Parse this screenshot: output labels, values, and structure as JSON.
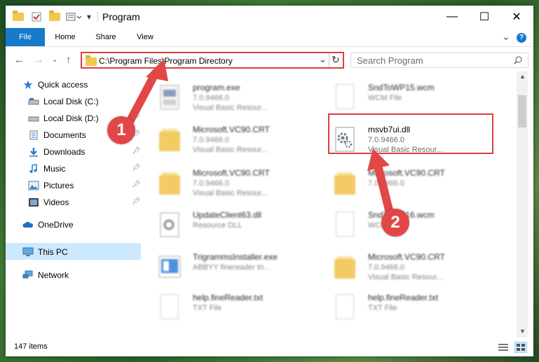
{
  "window": {
    "title": "Program",
    "minimize_glyph": "—",
    "maximize_glyph": "☐",
    "close_glyph": "✕"
  },
  "ribbon": {
    "tabs": [
      "File",
      "Home",
      "Share",
      "View"
    ],
    "expand_glyph": "⌄",
    "help_glyph": "?"
  },
  "address": {
    "path": "C:\\Program Files\\Program Directory",
    "dropdown_glyph": "⌄",
    "refresh_glyph": "↻"
  },
  "search": {
    "placeholder": "Search Program",
    "icon": "search-icon"
  },
  "sidebar": {
    "items": [
      {
        "label": "Quick access",
        "icon": "star-icon"
      },
      {
        "label": "Local Disk (C:)",
        "icon": "drive-icon"
      },
      {
        "label": "Local Disk (D:)",
        "icon": "drive-icon"
      },
      {
        "label": "Documents",
        "icon": "documents-icon"
      },
      {
        "label": "Downloads",
        "icon": "download-icon"
      },
      {
        "label": "Music",
        "icon": "music-icon"
      },
      {
        "label": "Pictures",
        "icon": "pictures-icon"
      },
      {
        "label": "Videos",
        "icon": "videos-icon"
      },
      {
        "label": "OneDrive",
        "icon": "cloud-icon"
      },
      {
        "label": "This PC",
        "icon": "computer-icon"
      },
      {
        "label": "Network",
        "icon": "network-icon"
      }
    ]
  },
  "files": [
    {
      "name": "program.exe",
      "line2": "7.0.9466.0",
      "line3": "Visual Basic Resour...",
      "type": "exe"
    },
    {
      "name": "SndToWP15.wcm",
      "line2": "WCM File",
      "line3": "",
      "type": "doc"
    },
    {
      "name": "Microsoft.VC90.CRT",
      "line2": "7.0.9466.0",
      "line3": "Visual Basic Resour...",
      "type": "folder"
    },
    {
      "name": "msvb7ui.dll",
      "line2": "7.0.9466.0",
      "line3": "Visual Basic Resour...",
      "type": "dll"
    },
    {
      "name": "Microsoft.VC90.CRT",
      "line2": "7.0.9466.0",
      "line3": "Visual Basic Resour...",
      "type": "folder"
    },
    {
      "name": "Microsoft.VC90.CRT",
      "line2": "7.0.9466.0",
      "line3": "",
      "type": "folder"
    },
    {
      "name": "UpdateClient63.dll",
      "line2": "Resource DLL",
      "line3": "",
      "type": "dll"
    },
    {
      "name": "SndToWP16.wcm",
      "line2": "WCM File",
      "line3": "",
      "type": "doc"
    },
    {
      "name": "TrigrammsInstaller.exe",
      "line2": "ABBYY finereader tri...",
      "line3": "",
      "type": "installer"
    },
    {
      "name": "Microsoft.VC90.CRT",
      "line2": "7.0.9466.0",
      "line3": "Visual Basic Resour...",
      "type": "folder"
    },
    {
      "name": "help.fineReader.txt",
      "line2": "TXT File",
      "line3": "",
      "type": "doc"
    },
    {
      "name": "help.fineReader.txt",
      "line2": "TXT File",
      "line3": "",
      "type": "doc"
    }
  ],
  "status": {
    "item_count": "147 items"
  },
  "annotations": {
    "badge1": "1",
    "badge2": "2"
  },
  "colors": {
    "accent": "#1979ca",
    "highlight": "#e03c3c",
    "selected": "#cce8ff"
  }
}
